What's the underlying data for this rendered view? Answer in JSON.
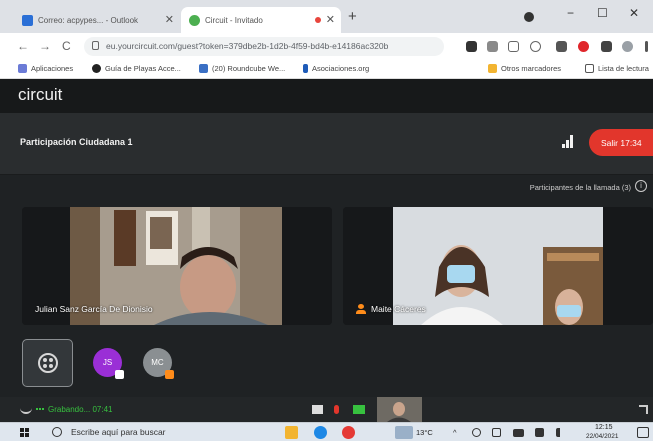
{
  "browser": {
    "tabs": [
      {
        "title": "Correo: acpypes... - Outlook",
        "color": "#2a6fd6"
      },
      {
        "title": "Circuit - Invitado",
        "color": "#4caf50"
      }
    ],
    "new_tab": "+",
    "window_controls": {
      "minimize": "−",
      "maximize": "☐",
      "close": "✕"
    },
    "nav": {
      "back": "←",
      "forward": "→",
      "reload": "C"
    },
    "url": "eu.yourcircuit.com/guest?token=379dbe2b-1d2b-4f59-bd4b-e14186ac320b",
    "bookmarks": [
      {
        "label": "Aplicaciones",
        "color": "#6b7bd6"
      },
      {
        "label": "Guía de Playas Acce...",
        "color": "#222222"
      },
      {
        "label": "(20) Roundcube We...",
        "color": "#3a6fc4"
      },
      {
        "label": "Asociaciones.org",
        "color": "#1e5bb8"
      },
      {
        "label": "Otros marcadores",
        "color": "#f2b431"
      },
      {
        "label": "Lista de lectura",
        "color": "#555555"
      }
    ]
  },
  "app": {
    "brand": "circuit",
    "call_title": "Participación Ciudadana 1",
    "leave_button": "Salir 17:34",
    "participants_label": "Participantes de la llamada (3)",
    "info_icon": "i",
    "tiles": [
      {
        "name": "Julian Sanz García De Dionisio",
        "presenter": false
      },
      {
        "name": "Maite Cáceres",
        "presenter": true
      }
    ],
    "avatars": [
      {
        "initials": "JS",
        "color": "#9a2fd6"
      },
      {
        "initials": "MC",
        "color": "#8a8f92"
      }
    ],
    "recording_label": "Grabando... 07:41",
    "colors": {
      "leave": "#e2362c",
      "recording": "#37c13f",
      "background": "#1f2224"
    }
  },
  "taskbar": {
    "search_placeholder": "Escribe aquí para buscar",
    "temperature": "13°C",
    "time": "12:15",
    "date": "22/04/2021"
  }
}
